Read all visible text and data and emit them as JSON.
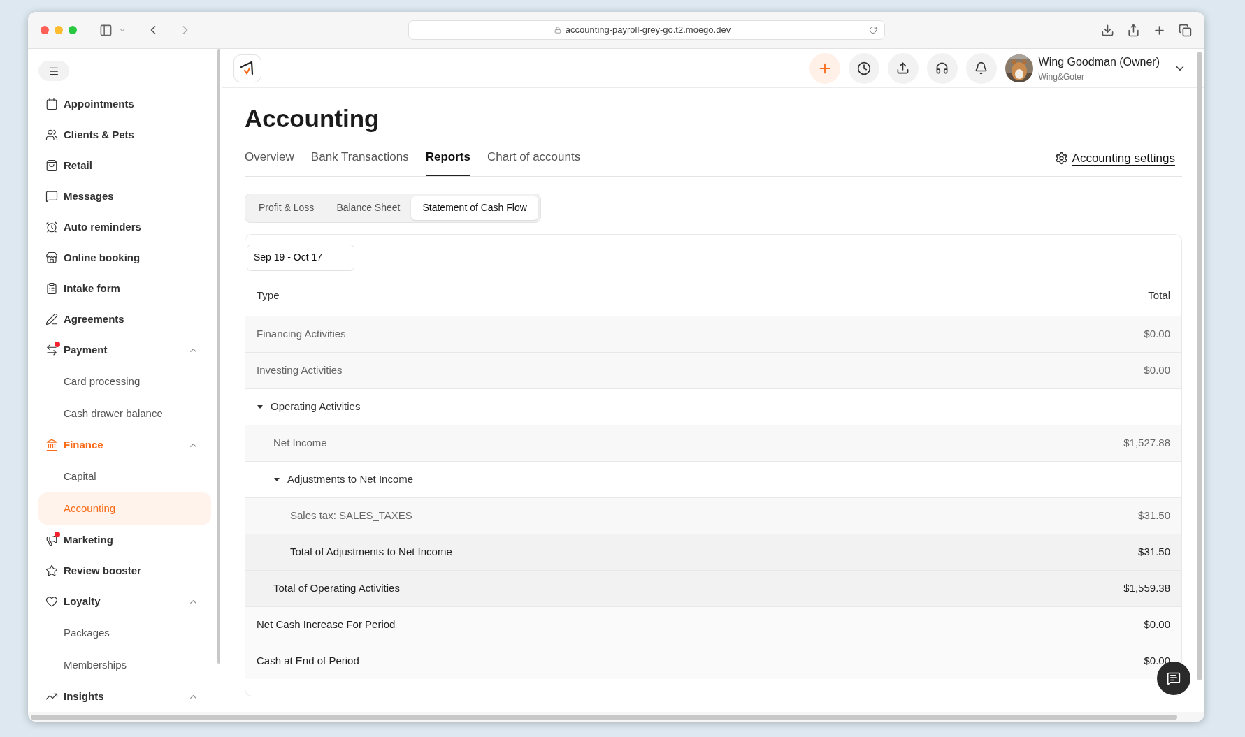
{
  "browser": {
    "url": "accounting-payroll-grey-go.t2.moego.dev"
  },
  "sidebar": {
    "items": [
      {
        "label": "Appointments",
        "notification": false
      },
      {
        "label": "Clients & Pets",
        "notification": false
      },
      {
        "label": "Retail",
        "notification": false
      },
      {
        "label": "Messages",
        "notification": false
      },
      {
        "label": "Auto reminders",
        "notification": false
      },
      {
        "label": "Online booking",
        "notification": false
      },
      {
        "label": "Intake form",
        "notification": false
      },
      {
        "label": "Agreements",
        "notification": false
      },
      {
        "label": "Payment",
        "notification": true,
        "expanded": true,
        "children": [
          {
            "label": "Card processing",
            "selected": false
          },
          {
            "label": "Cash drawer balance",
            "selected": false
          }
        ]
      },
      {
        "label": "Finance",
        "notification": false,
        "expanded": true,
        "children": [
          {
            "label": "Capital",
            "selected": false
          },
          {
            "label": "Accounting",
            "selected": true
          }
        ]
      },
      {
        "label": "Marketing",
        "notification": true
      },
      {
        "label": "Review booster",
        "notification": false
      },
      {
        "label": "Loyalty",
        "notification": false,
        "expanded": true,
        "children": [
          {
            "label": "Packages",
            "selected": false
          },
          {
            "label": "Memberships",
            "selected": false
          }
        ]
      },
      {
        "label": "Insights",
        "notification": false,
        "expanded": true
      }
    ]
  },
  "user": {
    "name": "Wing Goodman (Owner)",
    "business": "Wing&Goter"
  },
  "page": {
    "title": "Accounting"
  },
  "tabs": [
    {
      "label": "Overview",
      "selected": false
    },
    {
      "label": "Bank Transactions",
      "selected": false
    },
    {
      "label": "Reports",
      "selected": true
    },
    {
      "label": "Chart of accounts",
      "selected": false
    }
  ],
  "settings_link": "Accounting settings",
  "report_tabs": [
    {
      "label": "Profit & Loss",
      "selected": false
    },
    {
      "label": "Balance Sheet",
      "selected": false
    },
    {
      "label": "Statement of Cash Flow",
      "selected": true
    }
  ],
  "date_range": "Sep 19 - Oct 17",
  "table": {
    "columns": [
      "Type",
      "Total"
    ],
    "rows": [
      {
        "kind": "line",
        "label": "Financing Activities",
        "total": "$0.00"
      },
      {
        "kind": "line",
        "label": "Investing Activities",
        "total": "$0.00"
      },
      {
        "kind": "group",
        "label": "Operating Activities",
        "expanded": true,
        "children": [
          {
            "kind": "line",
            "label": "Net Income",
            "total": "$1,527.88"
          },
          {
            "kind": "group",
            "label": "Adjustments to Net Income",
            "expanded": true,
            "children": [
              {
                "kind": "line",
                "label": "Sales tax: SALES_TAXES",
                "total": "$31.50"
              },
              {
                "kind": "total",
                "label": "Total of Adjustments to Net Income",
                "total": "$31.50"
              }
            ]
          },
          {
            "kind": "total",
            "label": "Total of Operating Activities",
            "total": "$1,559.38"
          }
        ]
      },
      {
        "kind": "summary",
        "label": "Net Cash Increase For Period",
        "total": "$0.00"
      },
      {
        "kind": "summary",
        "label": "Cash at End of Period",
        "total": "$0.00"
      }
    ]
  }
}
